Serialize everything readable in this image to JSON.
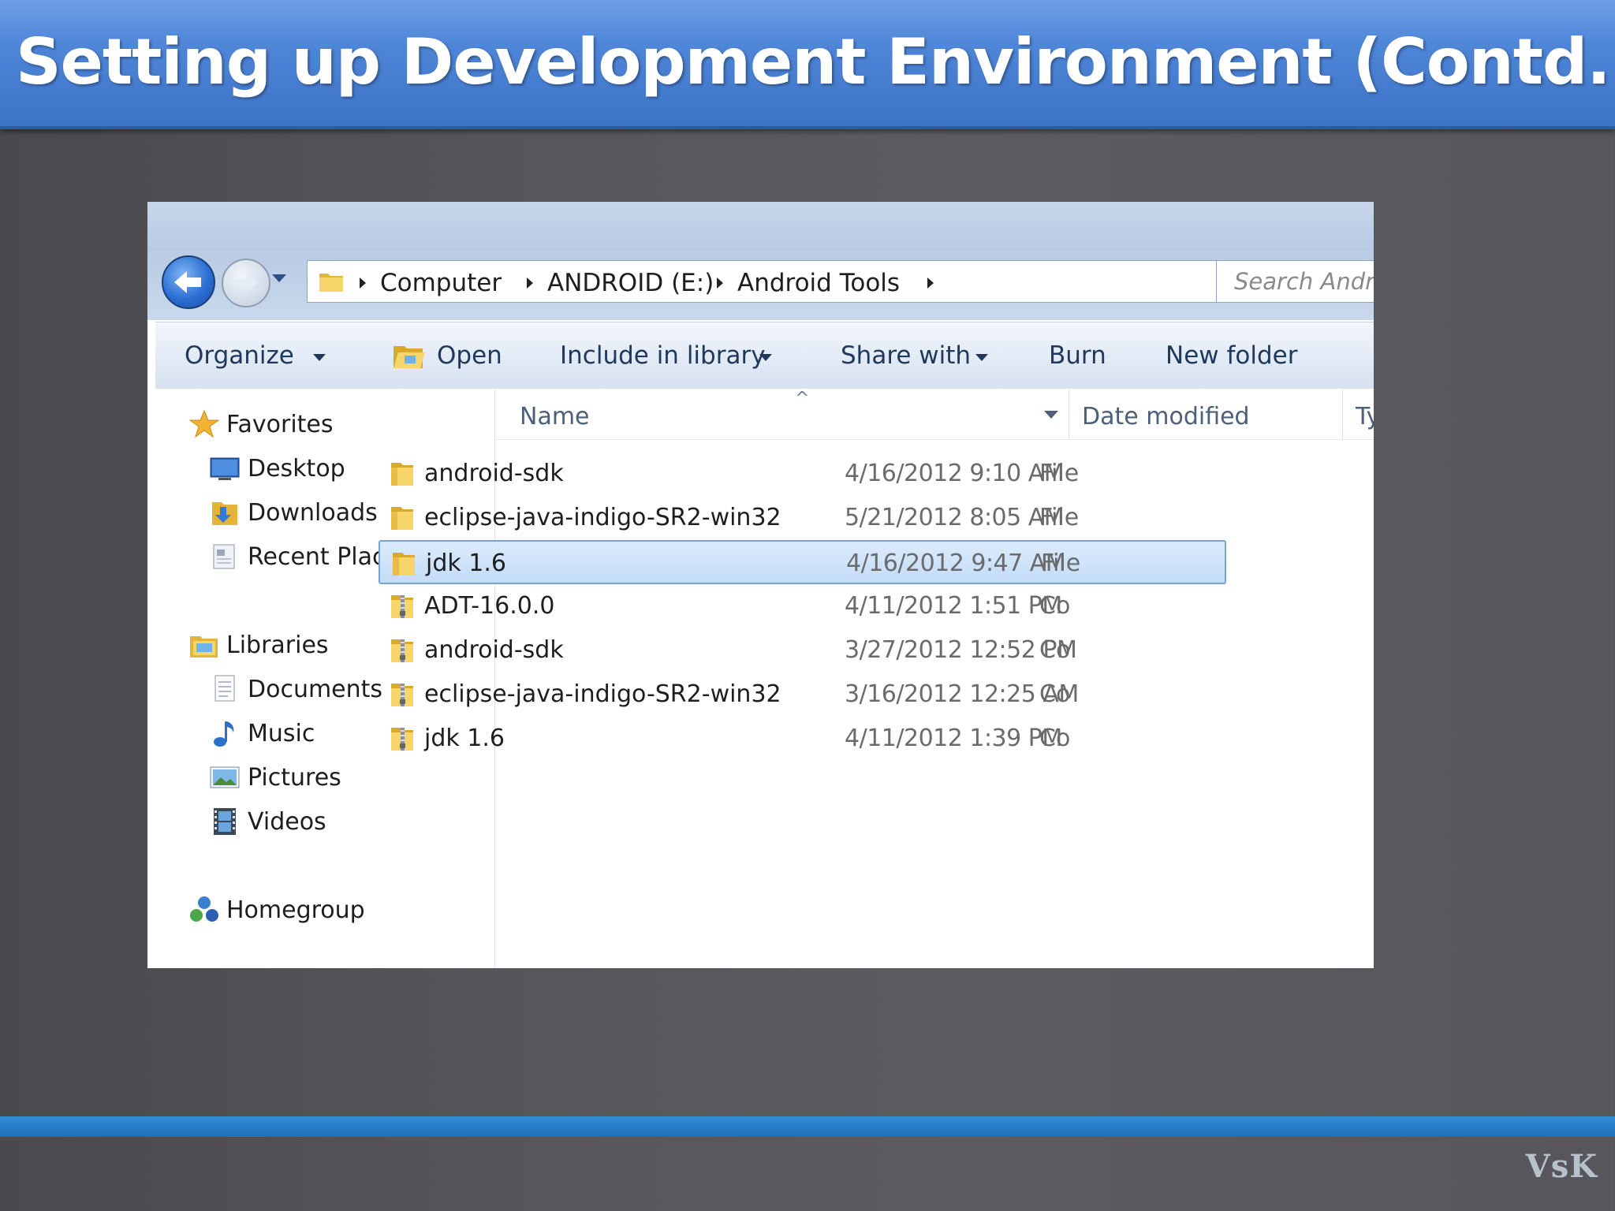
{
  "slide": {
    "title": "Setting up Development Environment (Contd.)",
    "footer_logo": "VsK"
  },
  "explorer": {
    "breadcrumb": [
      "Computer",
      "ANDROID (E:)",
      "Android Tools"
    ],
    "search_placeholder": "Search Andr",
    "toolbar": {
      "organize": "Organize",
      "open": "Open",
      "include_in_library": "Include in library",
      "share_with": "Share with",
      "burn": "Burn",
      "new_folder": "New folder"
    },
    "nav": {
      "favorites": "Favorites",
      "desktop": "Desktop",
      "downloads": "Downloads",
      "recent_places": "Recent Places",
      "libraries": "Libraries",
      "documents": "Documents",
      "music": "Music",
      "pictures": "Pictures",
      "videos": "Videos",
      "homegroup": "Homegroup"
    },
    "columns": {
      "name": "Name",
      "date_modified": "Date modified",
      "type": "Typ"
    },
    "files": [
      {
        "name": "android-sdk",
        "date": "4/16/2012 9:10 AM",
        "type": "File",
        "kind": "folder",
        "selected": false
      },
      {
        "name": "eclipse-java-indigo-SR2-win32",
        "date": "5/21/2012 8:05 AM",
        "type": "File",
        "kind": "folder",
        "selected": false
      },
      {
        "name": "jdk 1.6",
        "date": "4/16/2012 9:47 AM",
        "type": "File",
        "kind": "folder",
        "selected": true
      },
      {
        "name": "ADT-16.0.0",
        "date": "4/11/2012 1:51 PM",
        "type": "Co",
        "kind": "zip",
        "selected": false
      },
      {
        "name": "android-sdk",
        "date": "3/27/2012 12:52 PM",
        "type": "Co",
        "kind": "zip",
        "selected": false
      },
      {
        "name": "eclipse-java-indigo-SR2-win32",
        "date": "3/16/2012 12:25 AM",
        "type": "Co",
        "kind": "zip",
        "selected": false
      },
      {
        "name": "jdk 1.6",
        "date": "4/11/2012 1:39 PM",
        "type": "Co",
        "kind": "zip",
        "selected": false
      }
    ]
  }
}
